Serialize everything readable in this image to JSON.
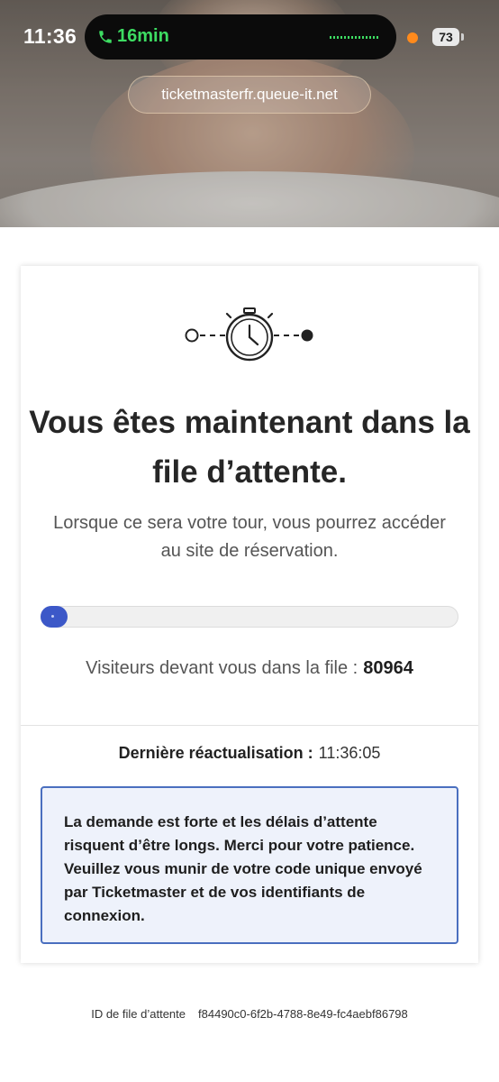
{
  "status_bar": {
    "time": "11:36",
    "call_duration": "16min",
    "battery": "73"
  },
  "browser": {
    "url": "ticketmasterfr.queue-it.net"
  },
  "queue": {
    "title": "Vous êtes maintenant dans la file d’attente.",
    "subtitle": "Lorsque ce sera votre tour, vous pourrez accéder au site de réservation.",
    "progress_fraction": 0.0,
    "visitors_label": "Visiteurs devant vous dans la file :",
    "visitors_count": "80964",
    "last_refresh_label": "Dernière réactualisation :",
    "last_refresh_time": "11:36:05",
    "notice": "La demande est forte et les délais d’attente risquent d’être longs. Merci pour votre patience. Veuillez vous munir de votre code unique envoyé par Ticketmaster et de vos identifiants de connexion.",
    "queue_id_label": "ID de file d’attente",
    "queue_id": "f84490c0-6f2b-4788-8e49-fc4aebf86798"
  },
  "icons": {
    "call": "phone-icon",
    "timer": "stopwatch-icon"
  },
  "colors": {
    "call_green": "#3ddc62",
    "progress_blue": "#3c58c8",
    "notice_border": "#4a6fbf",
    "notice_bg": "#eef2fb"
  }
}
